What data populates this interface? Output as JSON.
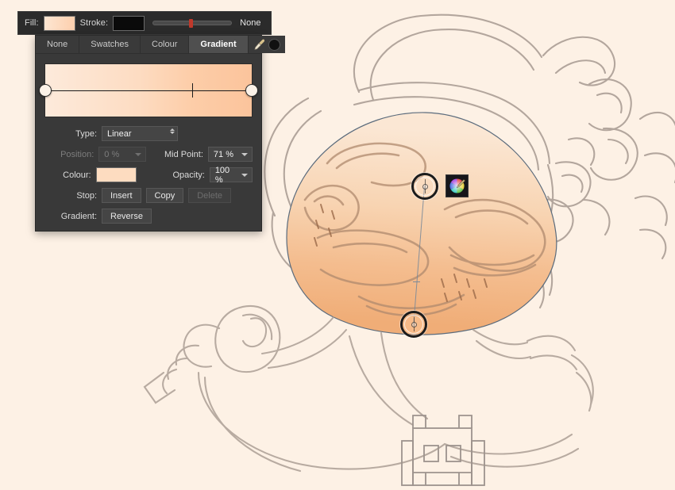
{
  "app": {
    "canvas_background": "#fdf1e5",
    "panel_background": "#393939",
    "accent_fill": "#fdcfad"
  },
  "context_bar": {
    "fill_label": "Fill:",
    "fill_swatch_color": "#fdd9b8",
    "stroke_label": "Stroke:",
    "stroke_swatch_color": "#0a0a0a",
    "stroke_width_value": "46",
    "stroke_none_label": "None"
  },
  "panel": {
    "tabs": [
      {
        "label": "None",
        "selected": false
      },
      {
        "label": "Swatches",
        "selected": false
      },
      {
        "label": "Colour",
        "selected": false
      },
      {
        "label": "Gradient",
        "selected": true
      }
    ],
    "tools": {
      "eyedropper": "eyedropper-icon",
      "colour_circle": "colour-circle-icon"
    },
    "gradient_preview": {
      "start_color": "#fdeadb",
      "end_color": "#fbc49c",
      "midpoint_percent": 71
    },
    "fields": {
      "type_label": "Type:",
      "type_value": "Linear",
      "position_label": "Position:",
      "position_value": "0 %",
      "position_disabled": true,
      "midpoint_label": "Mid Point:",
      "midpoint_value": "71 %",
      "colour_label": "Colour:",
      "colour_value": "#fddcc0",
      "opacity_label": "Opacity:",
      "opacity_value": "100 %",
      "stop_label": "Stop:",
      "stop_insert": "Insert",
      "stop_copy": "Copy",
      "stop_delete": "Delete",
      "gradient_label": "Gradient:",
      "gradient_reverse": "Reverse"
    }
  },
  "canvas": {
    "gradient_handles": {
      "start_handle": "gradient-start-handle",
      "end_handle": "gradient-end-handle",
      "midpoint_tick": "gradient-midpoint-tick"
    },
    "colour_popup_button": "colour-wheel-button",
    "artwork_description": "pencil sketch of cartoon character with peach gradient fill on head"
  }
}
